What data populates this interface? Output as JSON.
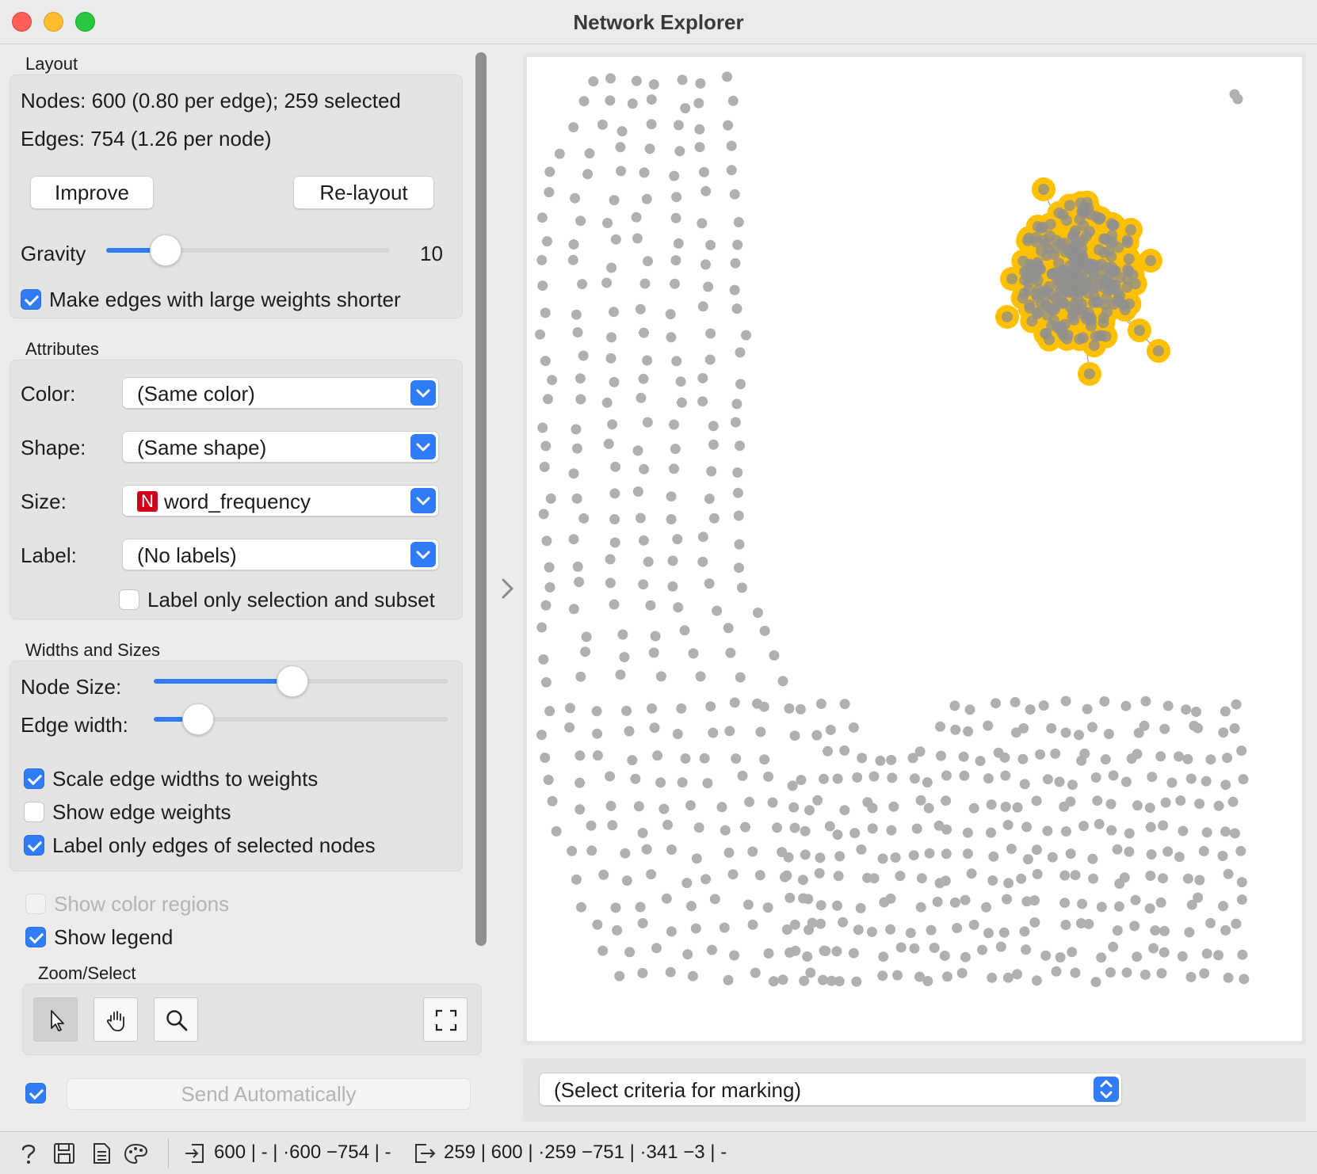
{
  "window": {
    "title": "Network Explorer"
  },
  "layout_section": {
    "title": "Layout",
    "nodes_text": "Nodes: 600 (0.80 per edge); 259 selected",
    "edges_text": "Edges: 754 (1.26 per node)",
    "improve_label": "Improve",
    "relayout_label": "Re-layout",
    "gravity_label": "Gravity",
    "gravity_value": "10",
    "gravity_fraction": 0.21,
    "shorter_edges_label": "Make edges with large weights shorter",
    "shorter_edges_checked": true
  },
  "attributes_section": {
    "title": "Attributes",
    "color_label": "Color:",
    "color_value": "(Same color)",
    "shape_label": "Shape:",
    "shape_value": "(Same shape)",
    "size_label": "Size:",
    "size_badge": "N",
    "size_value": "word_frequency",
    "label_label": "Label:",
    "label_value": "(No labels)",
    "label_only_selection_label": "Label only selection and subset",
    "label_only_selection_checked": false
  },
  "widths_section": {
    "title": "Widths and Sizes",
    "node_size_label": "Node Size:",
    "node_size_fraction": 0.47,
    "edge_width_label": "Edge width:",
    "edge_width_fraction": 0.15,
    "scale_edge_widths_label": "Scale edge widths to weights",
    "scale_edge_widths_checked": true,
    "show_edge_weights_label": "Show edge weights",
    "show_edge_weights_checked": false,
    "label_only_edges_label": "Label only edges of selected nodes",
    "label_only_edges_checked": true
  },
  "extras": {
    "show_color_regions_label": "Show color regions",
    "show_color_regions_checked": false,
    "show_legend_label": "Show legend",
    "show_legend_checked": true
  },
  "zoom_select": {
    "title": "Zoom/Select",
    "tools": [
      {
        "name": "select-tool",
        "icon": "pointer-arrow-icon",
        "active": true
      },
      {
        "name": "pan-tool",
        "icon": "hand-icon",
        "active": false
      },
      {
        "name": "zoom-tool",
        "icon": "magnifier-icon",
        "active": false
      },
      {
        "name": "fit-tool",
        "icon": "fit-screen-icon",
        "active": false
      }
    ]
  },
  "send": {
    "auto_checked": true,
    "label": "Send Automatically"
  },
  "marking": {
    "value": "(Select criteria for marking)"
  },
  "colors": {
    "accent": "#2f7cf6",
    "node": "#b0b0b0",
    "selected_halo": "#ffc000"
  },
  "status_bar": {
    "icons": [
      "help-icon",
      "save-icon",
      "report-icon",
      "palette-icon"
    ],
    "input_text": "600 | - | ·600 −754 | -",
    "output_text": "259 | 600 | ·259 −751 | ·341 −3 | -"
  }
}
